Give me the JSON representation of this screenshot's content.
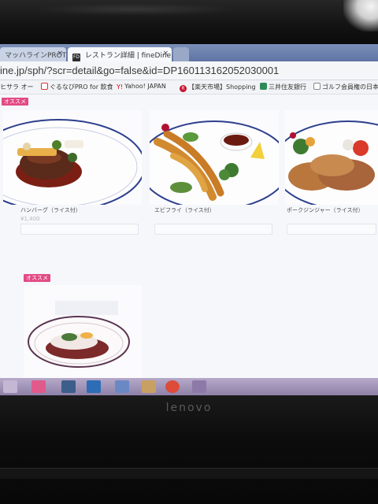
{
  "browser": {
    "tabs": [
      {
        "label": "マッハラインPROTO",
        "active": false
      },
      {
        "label": "レストラン詳細 | fineDine",
        "active": true
      }
    ],
    "address": "ine.jp/sph/?scr=detail&go=false&id=DP160113162052030001",
    "bookmarks": [
      {
        "label": "ヒサラ オー",
        "icon": "generic-icon"
      },
      {
        "label": "ぐるなびPRO for 飲食",
        "icon": "gurunavi-icon"
      },
      {
        "label": "Yahoo! JAPAN",
        "icon": "yahoo-icon"
      },
      {
        "label": "【楽天市場】Shopping",
        "icon": "rakuten-icon"
      },
      {
        "label": "三井住友銀行",
        "icon": "bank-icon"
      },
      {
        "label": "ゴルフ会員権の日本",
        "icon": "page-icon"
      }
    ]
  },
  "page": {
    "recommend_badge": "オススメ",
    "items": [
      {
        "name": "ハンバーグ（ライス付）",
        "price": "¥1,400",
        "button": ""
      },
      {
        "name": "エビフライ（ライス付）",
        "price": "",
        "button": ""
      },
      {
        "name": "ポークジンジャー（ライス付）",
        "price": "",
        "button": ""
      },
      {
        "name": "",
        "price": "",
        "button": ""
      }
    ]
  },
  "device": {
    "brand": "lenovo"
  },
  "colors": {
    "badge": "#e24a86",
    "tabstrip": "#6a7fb0",
    "taskbar": "#a194ba"
  }
}
